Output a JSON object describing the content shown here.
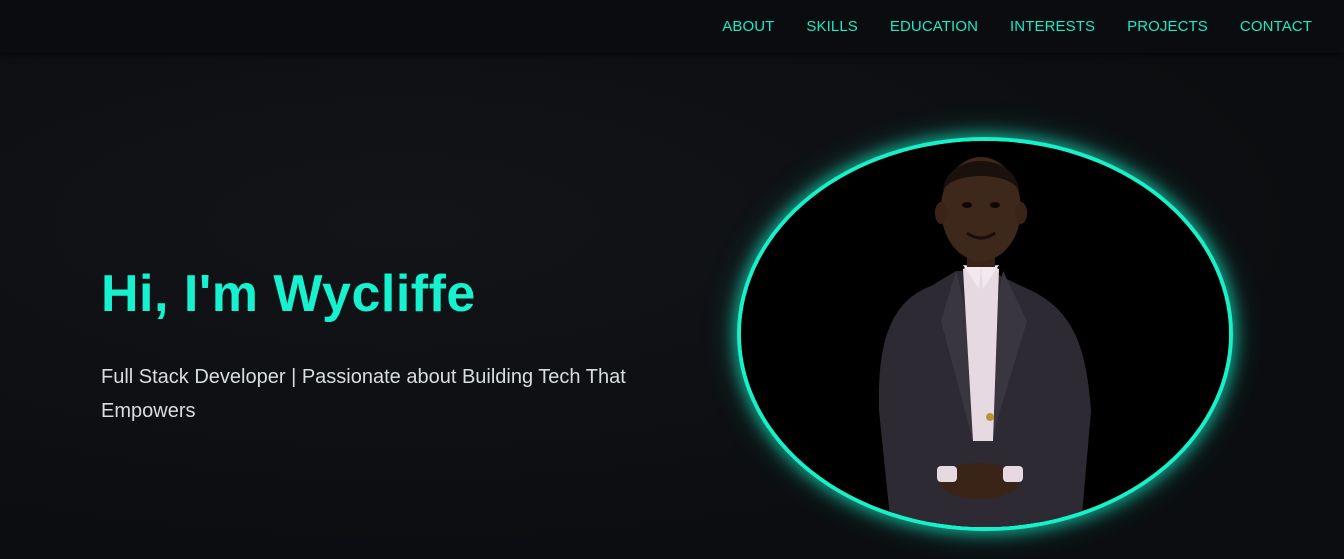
{
  "nav": {
    "items": [
      {
        "label": "ABOUT"
      },
      {
        "label": "SKILLS"
      },
      {
        "label": "EDUCATION"
      },
      {
        "label": "INTERESTS"
      },
      {
        "label": "PROJECTS"
      },
      {
        "label": "CONTACT"
      }
    ]
  },
  "hero": {
    "title": "Hi, I'm Wycliffe",
    "subtitle": "Full Stack Developer | Passionate about Building Tech That Empowers"
  },
  "colors": {
    "accent": "#17f0c8",
    "background": "#0d0f12",
    "text": "#d9dde0"
  }
}
